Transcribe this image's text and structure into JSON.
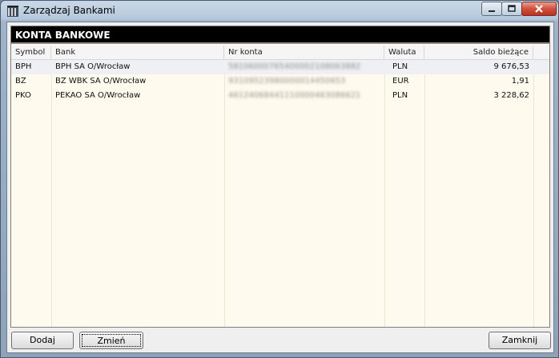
{
  "window": {
    "title": "Zarządzaj Bankami"
  },
  "panel": {
    "header": "KONTA BANKOWE",
    "columns": [
      "Symbol",
      "Bank",
      "Nr konta",
      "Waluta",
      "Saldo bieżące"
    ],
    "rows": [
      {
        "symbol": "BPH",
        "bank": "BPH SA O/Wrocław",
        "account": "58106000765400002108063882",
        "currency": "PLN",
        "balance": "9 676,53"
      },
      {
        "symbol": "BZ",
        "bank": "BZ WBK SA O/Wrocław",
        "account": "93109523980000014450653",
        "currency": "EUR",
        "balance": "1,91"
      },
      {
        "symbol": "PKO",
        "bank": "PEKAO SA O/Wrocław",
        "account": "46124068441110000463086621",
        "currency": "PLN",
        "balance": "3 228,62"
      }
    ]
  },
  "buttons": {
    "add": "Dodaj",
    "edit": "Zmień",
    "close": "Zamknij"
  }
}
